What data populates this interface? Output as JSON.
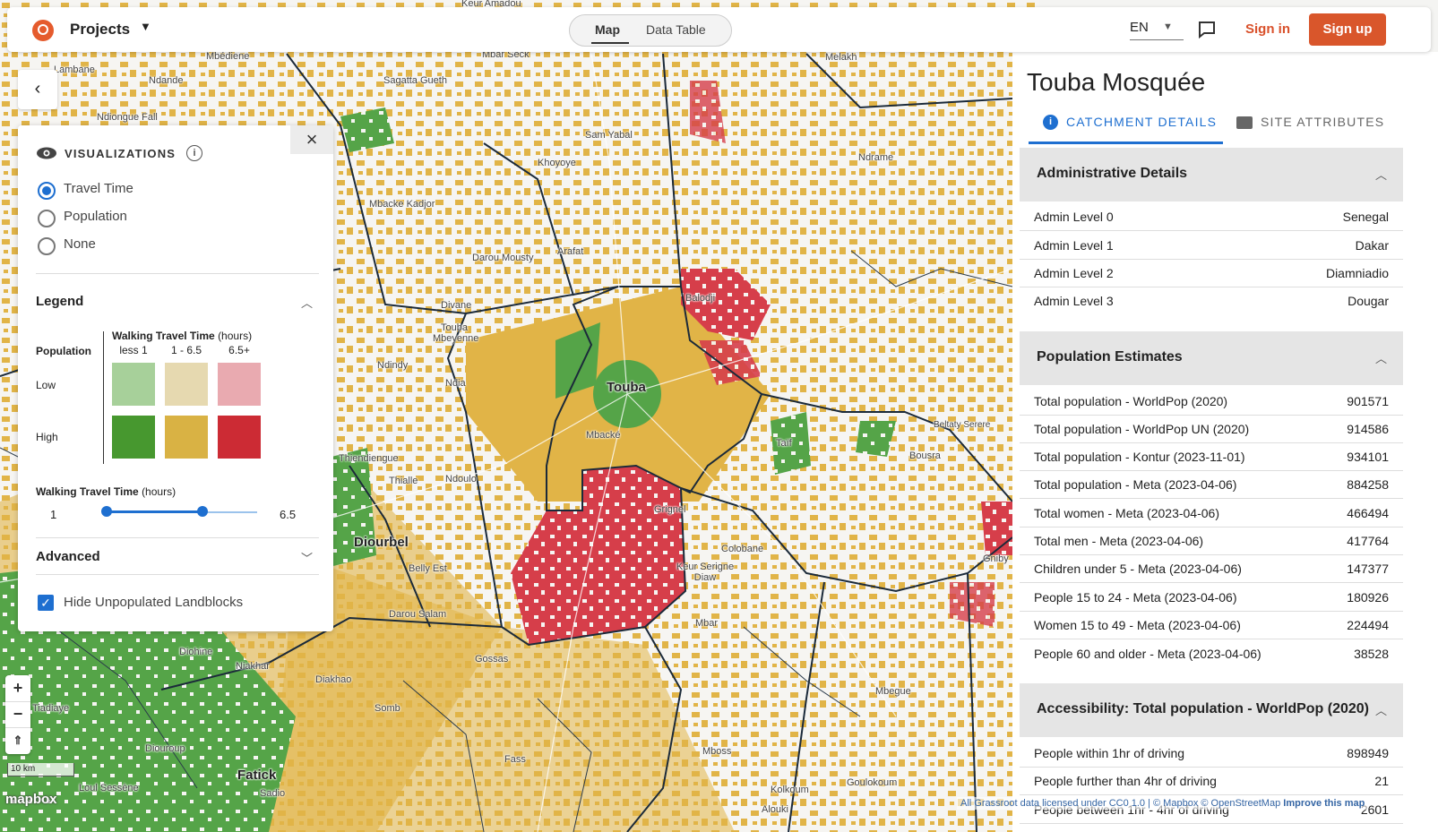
{
  "topbar": {
    "projects_label": "Projects",
    "tabs": {
      "map": "Map",
      "table": "Data Table"
    },
    "language": "EN",
    "sign_in": "Sign in",
    "sign_up": "Sign up"
  },
  "map": {
    "places": [
      {
        "name": "Touba",
        "major": true
      },
      {
        "name": "Mbacké",
        "major": false
      },
      {
        "name": "Diourbel",
        "major": true
      },
      {
        "name": "Fatick",
        "major": true
      },
      {
        "name": "Sam Yabal",
        "major": false
      },
      {
        "name": "Khoyoye",
        "major": false
      },
      {
        "name": "Darou Mousty",
        "major": false
      },
      {
        "name": "Arafat",
        "major": false
      },
      {
        "name": "Mbacke Kadjor",
        "major": false
      },
      {
        "name": "Sagatta Gueth",
        "major": false
      },
      {
        "name": "Mbar Seck",
        "major": false
      },
      {
        "name": "Ndande",
        "major": false
      },
      {
        "name": "Ndiongue Fall",
        "major": false
      },
      {
        "name": "Touba Mbeyenne",
        "major": false
      },
      {
        "name": "Divane",
        "major": false
      },
      {
        "name": "Ndindy",
        "major": false
      },
      {
        "name": "Ndia",
        "major": false
      },
      {
        "name": "Thiendiengue",
        "major": false
      },
      {
        "name": "Thialle",
        "major": false
      },
      {
        "name": "Ndoulo",
        "major": false
      },
      {
        "name": "Belly Est",
        "major": false
      },
      {
        "name": "Grignel",
        "major": false
      },
      {
        "name": "Keur Serigne Diaw",
        "major": false
      },
      {
        "name": "Colobane",
        "major": false
      },
      {
        "name": "Darou Salam",
        "major": false
      },
      {
        "name": "Gossas",
        "major": false
      },
      {
        "name": "Diakhao",
        "major": false
      },
      {
        "name": "Niakhar",
        "major": false
      },
      {
        "name": "Diohine",
        "major": false
      },
      {
        "name": "Somb",
        "major": false
      },
      {
        "name": "Mbar",
        "major": false
      },
      {
        "name": "Mboss",
        "major": false
      },
      {
        "name": "Fass",
        "major": false
      },
      {
        "name": "Taïf",
        "major": false
      },
      {
        "name": "Bousra",
        "major": false
      },
      {
        "name": "Beltaty Serere",
        "major": false
      },
      {
        "name": "Balodji",
        "major": false
      },
      {
        "name": "Ndrame",
        "major": false
      },
      {
        "name": "Melakh",
        "major": false
      },
      {
        "name": "Mbegue",
        "major": false
      },
      {
        "name": "Gniby",
        "major": false
      },
      {
        "name": "Mbédiene",
        "major": false
      },
      {
        "name": "Loul Sessène",
        "major": false
      },
      {
        "name": "Diouroup",
        "major": false
      },
      {
        "name": "Kolkoum",
        "major": false
      },
      {
        "name": "Goulokoum",
        "major": false
      },
      {
        "name": "Alouki",
        "major": false
      },
      {
        "name": "Keur Amadou",
        "major": false
      },
      {
        "name": "Lambane",
        "major": false
      },
      {
        "name": "Tiadiaye",
        "major": false
      },
      {
        "name": "Sadio",
        "major": false
      }
    ],
    "colors": {
      "green": "#55a448",
      "yellow": "#e1b447",
      "red": "#d63e4a",
      "border": "#1b2a3a"
    },
    "scale_label": "10 km",
    "mapbox_logo": "mapbox",
    "attribution": "All Grassroot data licensed under CC0 1.0 | © Mapbox © OpenStreetMap",
    "improve": "Improve this map"
  },
  "vis": {
    "title": "VISUALIZATIONS",
    "options": [
      {
        "label": "Travel Time",
        "selected": true
      },
      {
        "label": "Population",
        "selected": false
      },
      {
        "label": "None",
        "selected": false
      }
    ],
    "legend": {
      "title": "Legend",
      "population_label": "Population",
      "low": "Low",
      "high": "High",
      "wtt": "Walking Travel Time",
      "wtt_unit": "(hours)",
      "columns": [
        "less 1",
        "1 - 6.5",
        "6.5+"
      ],
      "colors_low": [
        "#a7d09a",
        "#e6d9b0",
        "#e9aab0"
      ],
      "colors_high": [
        "#47982f",
        "#d9b244",
        "#cc2b34"
      ]
    },
    "slider": {
      "title": "Walking Travel Time",
      "unit": "(hours)",
      "min": "1",
      "max": "6.5",
      "low_value": 1,
      "high_value": 4.5
    },
    "advanced": "Advanced",
    "hide_unpopulated": "Hide Unpopulated Landblocks"
  },
  "panel": {
    "site_title": "Touba Mosquée",
    "tabs": [
      "CATCHMENT DETAILS",
      "SITE ATTRIBUTES"
    ],
    "sections": [
      {
        "title": "Administrative Details",
        "rows": [
          {
            "k": "Admin Level 0",
            "v": "Senegal"
          },
          {
            "k": "Admin Level 1",
            "v": "Dakar"
          },
          {
            "k": "Admin Level 2",
            "v": "Diamniadio"
          },
          {
            "k": "Admin Level 3",
            "v": "Dougar"
          }
        ]
      },
      {
        "title": "Population Estimates",
        "rows": [
          {
            "k": "Total population - WorldPop (2020)",
            "v": "901571"
          },
          {
            "k": "Total population - WorldPop UN (2020)",
            "v": "914586"
          },
          {
            "k": "Total population - Kontur (2023-11-01)",
            "v": "934101"
          },
          {
            "k": "Total population - Meta (2023-04-06)",
            "v": "884258"
          },
          {
            "k": "Total women - Meta (2023-04-06)",
            "v": "466494"
          },
          {
            "k": "Total men - Meta (2023-04-06)",
            "v": "417764"
          },
          {
            "k": "Children under 5 - Meta (2023-04-06)",
            "v": "147377"
          },
          {
            "k": "People 15 to 24 - Meta (2023-04-06)",
            "v": "180926"
          },
          {
            "k": "Women 15 to 49 - Meta (2023-04-06)",
            "v": "224494"
          },
          {
            "k": "People 60 and older - Meta (2023-04-06)",
            "v": "38528"
          }
        ]
      },
      {
        "title": "Accessibility: Total population - WorldPop (2020)",
        "rows": [
          {
            "k": "People within 1hr of driving",
            "v": "898949"
          },
          {
            "k": "People further than 4hr of driving",
            "v": "21"
          },
          {
            "k": "People between 1hr - 4hr of driving",
            "v": "2601"
          }
        ]
      }
    ]
  }
}
